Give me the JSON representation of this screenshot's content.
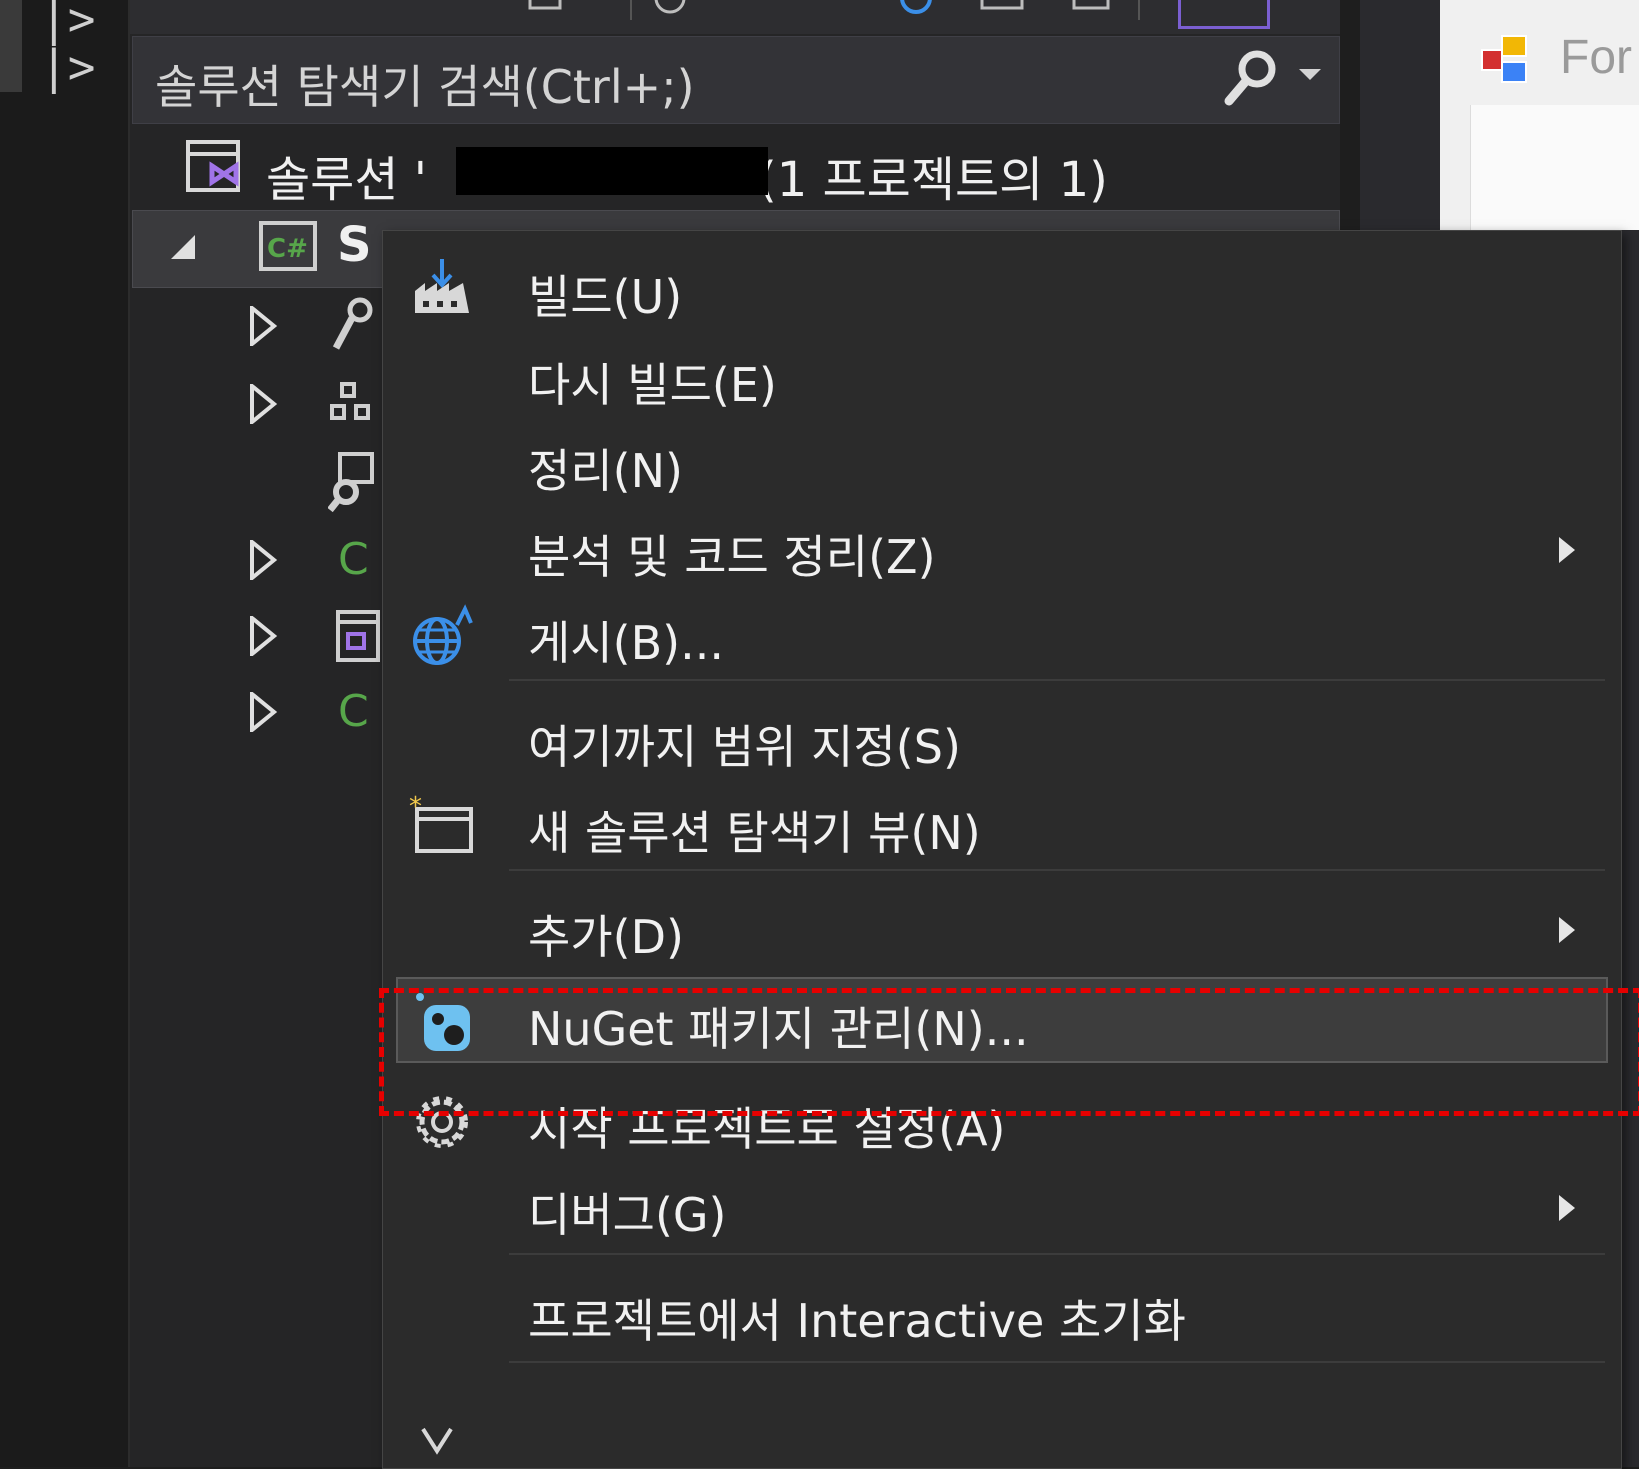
{
  "search": {
    "placeholder": "솔루션 탐색기 검색(Ctrl+;)"
  },
  "solution": {
    "prefix": "솔루션 '",
    "suffix": "(1 프로젝트의 1)"
  },
  "project": {
    "name_visible": "S"
  },
  "right_panel": {
    "form_label": "For"
  },
  "context_menu": {
    "items": [
      {
        "label": "빌드(U)",
        "icon": "build-icon",
        "submenu": false
      },
      {
        "label": "다시 빌드(E)",
        "icon": "",
        "submenu": false
      },
      {
        "label": "정리(N)",
        "icon": "",
        "submenu": false
      },
      {
        "label": "분석 및 코드 정리(Z)",
        "icon": "",
        "submenu": true
      },
      {
        "label": "게시(B)...",
        "icon": "globe-publish-icon",
        "submenu": false
      },
      {
        "label": "여기까지 범위 지정(S)",
        "icon": "",
        "submenu": false
      },
      {
        "label": "새 솔루션 탐색기 뷰(N)",
        "icon": "new-view-icon",
        "submenu": false
      },
      {
        "label": "추가(D)",
        "icon": "",
        "submenu": true
      },
      {
        "label": "NuGet 패키지 관리(N)...",
        "icon": "nuget-icon",
        "submenu": false,
        "highlighted": true
      },
      {
        "label": "시작 프로젝트로 설정(A)",
        "icon": "gear-icon",
        "submenu": false
      },
      {
        "label": "디버그(G)",
        "icon": "",
        "submenu": true
      },
      {
        "label": "프로젝트에서 Interactive 초기화",
        "icon": "",
        "submenu": false
      }
    ]
  },
  "colors": {
    "accent": "#7b5fd1",
    "highlight_border": "#e60000",
    "csharp_green": "#57a64a"
  }
}
